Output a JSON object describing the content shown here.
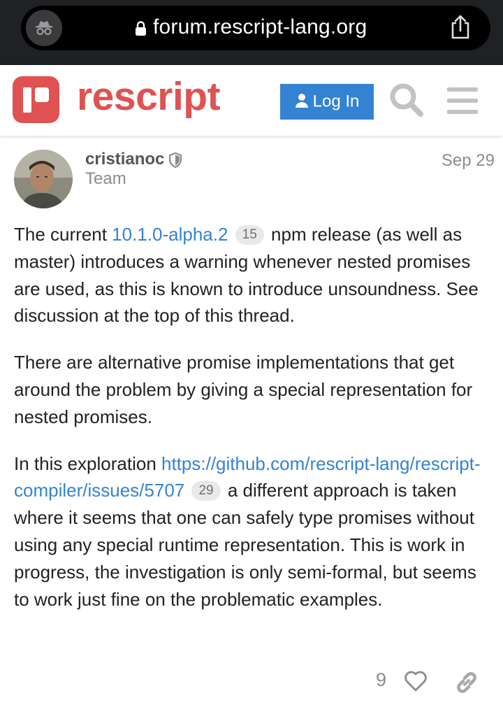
{
  "browser": {
    "url": "forum.rescript-lang.org",
    "icons": [
      "incognito-icon",
      "lock-icon",
      "share-icon"
    ]
  },
  "header": {
    "logo_text": "rescript",
    "login_label": "Log In",
    "icons": [
      "user-icon",
      "search-icon",
      "hamburger-icon"
    ]
  },
  "post": {
    "author": "cristianoc",
    "role": "Team",
    "date": "Sep 29",
    "p1_before": "The current ",
    "p1_link": "10.1.0-alpha.2",
    "p1_badge": "15",
    "p1_after": " npm release (as well as master) introduces a warning whenever nested promises are used, as this is known to introduce unsoundness. See discussion at the top of this thread.",
    "p2": "There are alternative promise implementations that get around the problem by giving a special representation for nested promises.",
    "p3_before": "In this exploration ",
    "p3_link": "https://github.com/rescript-lang/rescript-compiler/issues/5707",
    "p3_badge": "29",
    "p3_after": " a different approach is taken where it seems that one can safely type promises without using any special runtime representation. This is work in progress, the investigation is only semi-formal, but seems to work just fine on the problematic examples.",
    "like_count": "9"
  },
  "colors": {
    "brand": "#e05252",
    "link": "#3483d3",
    "browser_bg": "#202124"
  }
}
